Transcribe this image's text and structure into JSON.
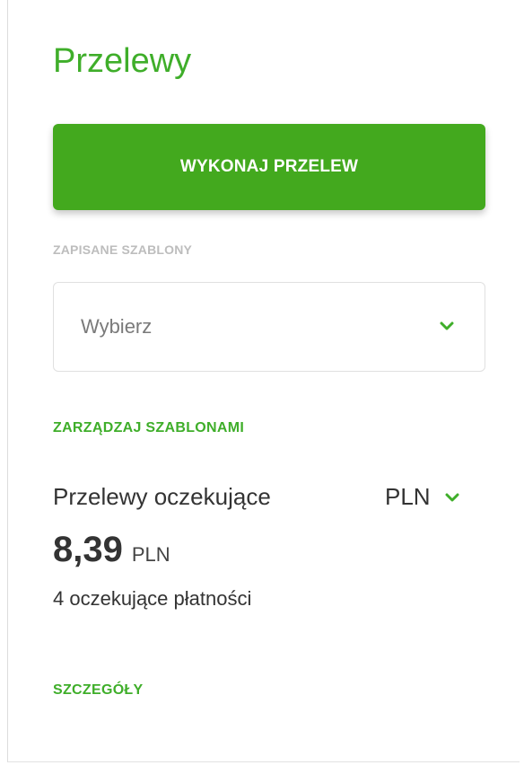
{
  "panel": {
    "title": "Przelewy",
    "primary_action": "WYKONAJ PRZELEW",
    "templates_label": "ZAPISANE SZABLONY",
    "templates_select": {
      "value": "Wybierz"
    },
    "manage_templates_link": "ZARZĄDZAJ SZABLONAMI",
    "pending": {
      "title": "Przelewy oczekujące",
      "currency": "PLN",
      "amount": "8,39",
      "amount_currency": "PLN",
      "count_text": "4 oczekujące płatności"
    },
    "details_link": "SZCZEGÓŁY"
  },
  "colors": {
    "accent_green": "#3fae2a",
    "button_green": "#43a91e",
    "muted_label": "#bdbdbd",
    "text_dark": "#333333"
  },
  "icons": {
    "select_chevron": "chevron-down-icon",
    "currency_chevron": "chevron-down-icon"
  }
}
